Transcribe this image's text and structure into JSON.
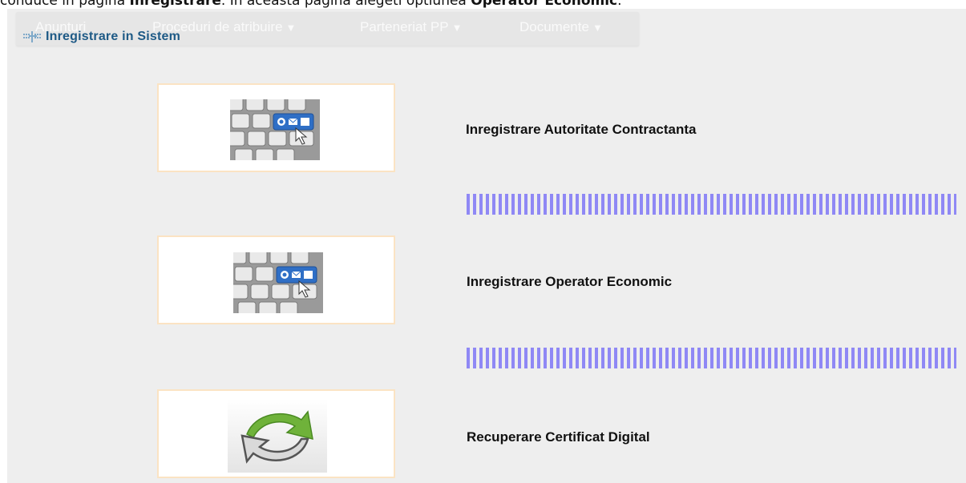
{
  "caption": {
    "part1": "conduce in pagina ",
    "bold1": "Inregistrare",
    "part2": ". In aceasta pagina alegeti optiunea ",
    "bold2": "Operator Economic",
    "part3": "."
  },
  "navbar": {
    "items": [
      {
        "label": "Anunturi"
      },
      {
        "label": "Proceduri de atribuire",
        "caret": "▼"
      },
      {
        "label": "Parteneriat PP",
        "caret": "▼"
      },
      {
        "label": "Documente",
        "caret": "▼"
      }
    ]
  },
  "page_title": "Inregistrare in Sistem",
  "options": [
    {
      "label": "Inregistrare Autoritate Contractanta",
      "icon": "keyboard-email-icon"
    },
    {
      "label": "Inregistrare Operator Economic",
      "icon": "keyboard-email-icon"
    },
    {
      "label": "Recuperare Certificat Digital",
      "icon": "refresh-arrows-icon"
    }
  ],
  "colors": {
    "title": "#1e5a86",
    "card_border": "#fbe3c3",
    "divider": "#8f88f5",
    "keyboard_blue": "#2f6fc6",
    "arrow_green": "#6fb23a"
  }
}
